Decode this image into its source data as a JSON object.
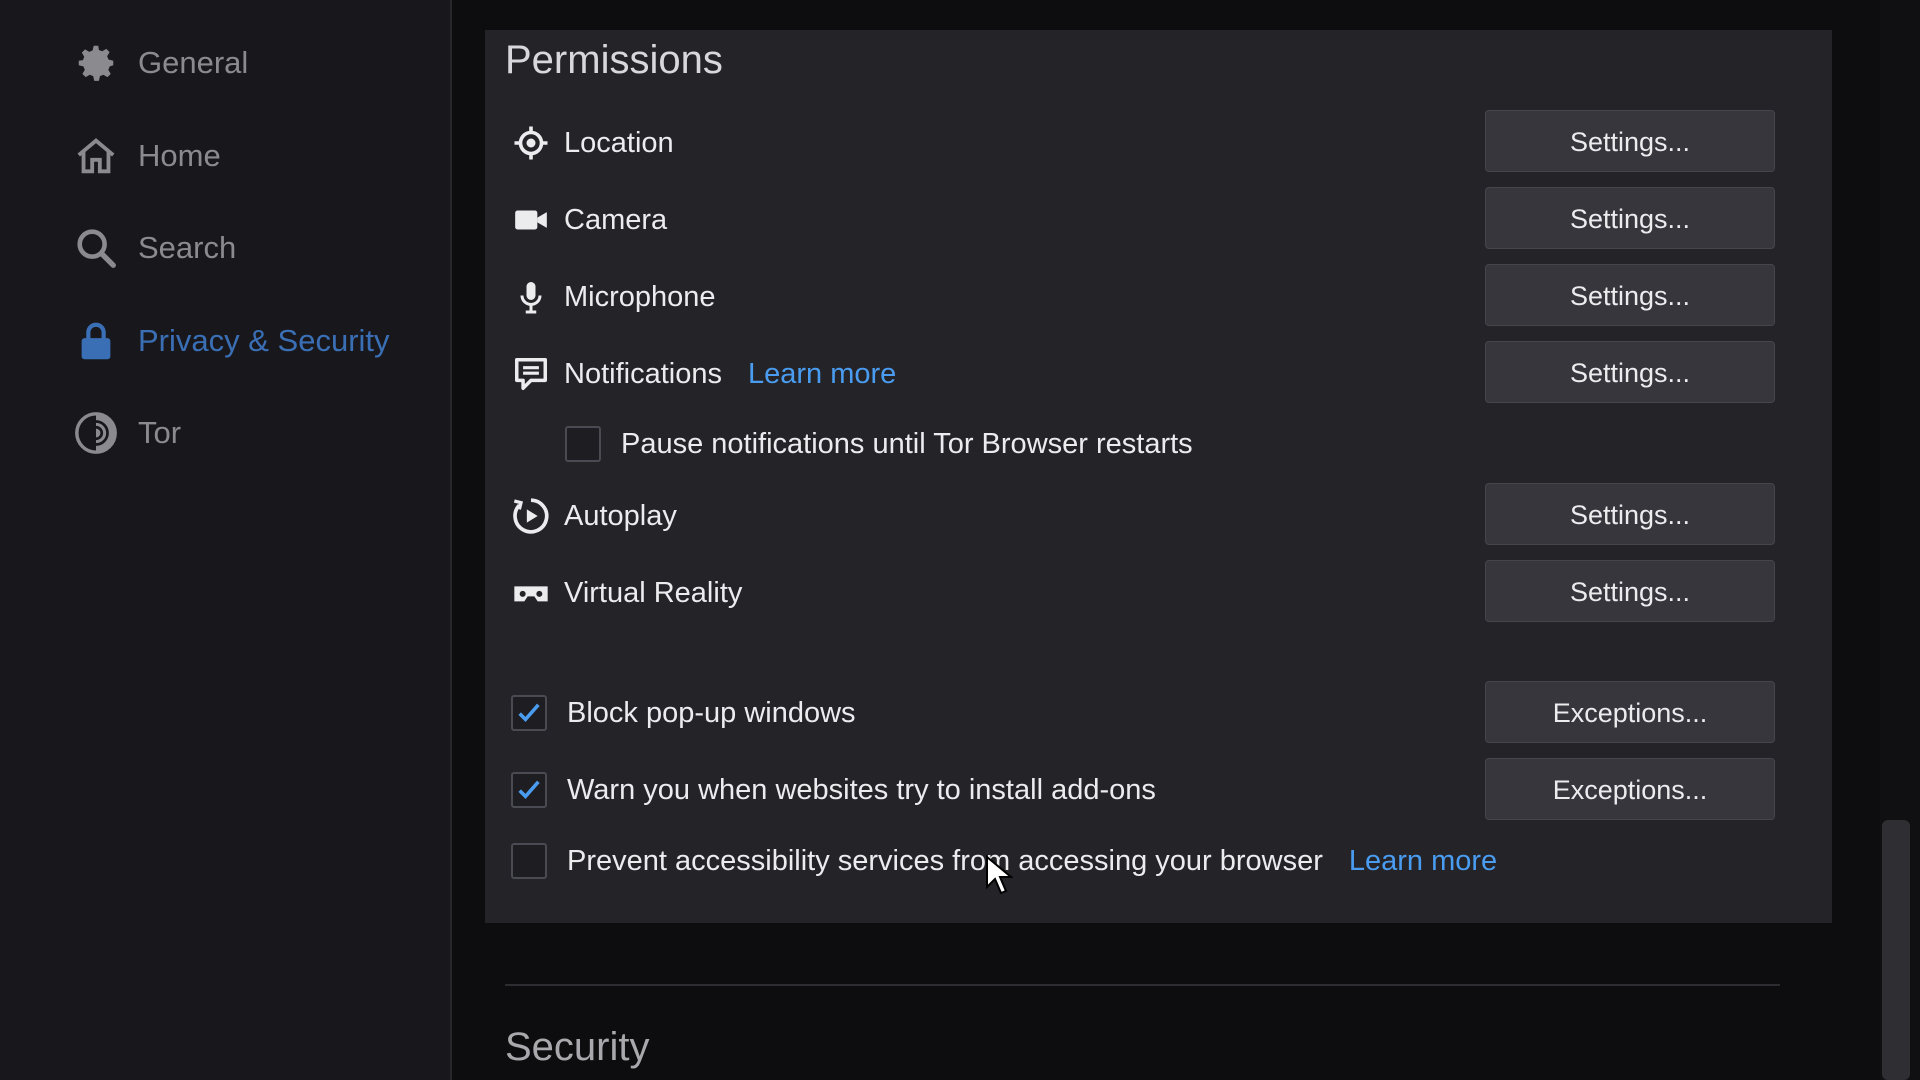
{
  "sidebar": {
    "items": [
      {
        "label": "General",
        "icon": "gear-icon"
      },
      {
        "label": "Home",
        "icon": "home-icon"
      },
      {
        "label": "Search",
        "icon": "search-icon"
      },
      {
        "label": "Privacy & Security",
        "icon": "lock-icon",
        "active": true
      },
      {
        "label": "Tor",
        "icon": "tor-onion-icon"
      }
    ]
  },
  "permissions": {
    "title": "Permissions",
    "rows": [
      {
        "label": "Location",
        "icon": "location-icon",
        "button": "Settings..."
      },
      {
        "label": "Camera",
        "icon": "camera-icon",
        "button": "Settings..."
      },
      {
        "label": "Microphone",
        "icon": "microphone-icon",
        "button": "Settings..."
      },
      {
        "label": "Notifications",
        "icon": "notification-icon",
        "link": "Learn more",
        "button": "Settings..."
      },
      {
        "label": "Autoplay",
        "icon": "autoplay-icon",
        "button": "Settings..."
      },
      {
        "label": "Virtual Reality",
        "icon": "vr-headset-icon",
        "button": "Settings..."
      }
    ],
    "pause_notifications": {
      "label": "Pause notifications until Tor Browser restarts",
      "checked": false
    },
    "block_popups": {
      "label": "Block pop-up windows",
      "checked": true,
      "button": "Exceptions..."
    },
    "warn_addons": {
      "label": "Warn you when websites try to install add-ons",
      "checked": true,
      "button": "Exceptions..."
    },
    "prevent_accessibility": {
      "label": "Prevent accessibility services from accessing your browser",
      "checked": false,
      "link": "Learn more"
    }
  },
  "security": {
    "title": "Security"
  },
  "colors": {
    "accent": "#4a9cf0",
    "active_nav": "#3a6fb5",
    "panel": "#232328",
    "sidebar": "#18181c"
  }
}
